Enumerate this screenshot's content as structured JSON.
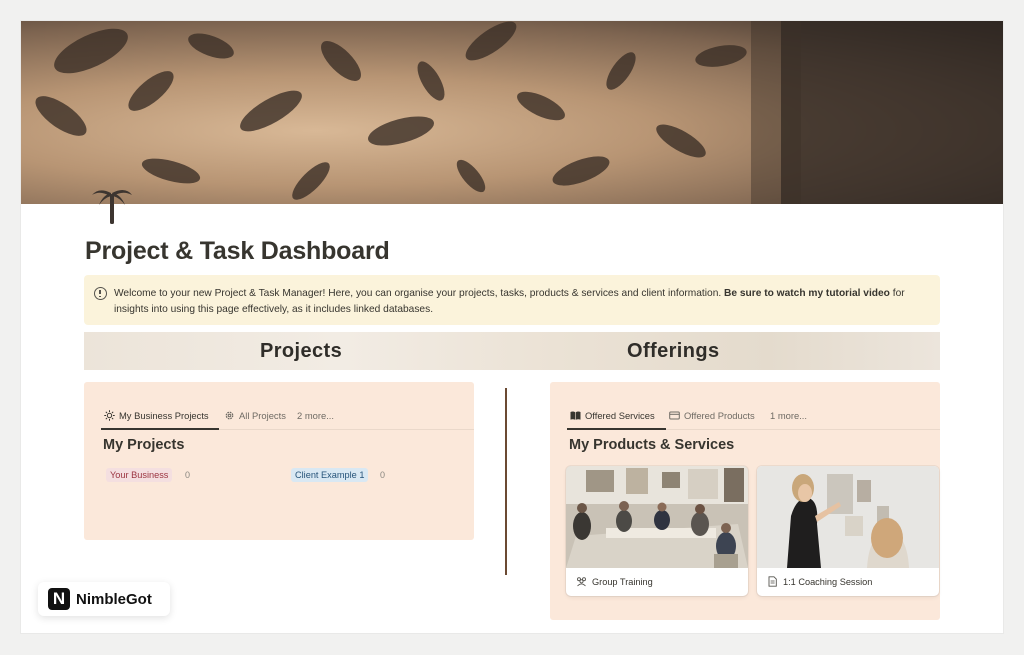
{
  "page": {
    "title": "Project & Task Dashboard",
    "callout": {
      "text_plain": "Welcome to your new Project & Task Manager! Here, you can organise your projects, tasks, products & services and client information. ",
      "text_bold": "Be sure to watch my tutorial video",
      "text_after": " for insights into using this page effectively, as it includes linked databases."
    },
    "sections": {
      "left": "Projects",
      "right": "Offerings"
    }
  },
  "projects": {
    "tabs": [
      {
        "label": "My Business Projects",
        "icon": "sun-icon",
        "active": true
      },
      {
        "label": "All Projects",
        "icon": "gear-icon",
        "active": false
      },
      {
        "label": "2 more...",
        "icon": null,
        "active": false
      }
    ],
    "title": "My Projects",
    "groups": [
      {
        "label": "Your Business",
        "count": "0",
        "color": "#f4dfe0",
        "text_color": "#9b3440"
      },
      {
        "label": "Client Example 1",
        "count": "0",
        "color": "#d9e8f3",
        "text_color": "#27547a"
      }
    ]
  },
  "offerings": {
    "tabs": [
      {
        "label": "Offered Services",
        "icon": "book-icon",
        "active": true
      },
      {
        "label": "Offered Products",
        "icon": "card-icon",
        "active": false
      },
      {
        "label": "1 more...",
        "icon": null,
        "active": false
      }
    ],
    "title": "My Products & Services",
    "cards": [
      {
        "label": "Group Training",
        "icon": "group-icon"
      },
      {
        "label": "1:1 Coaching Session",
        "icon": "document-icon"
      }
    ]
  },
  "badge": {
    "mark": "N",
    "brand": "NimbleGot"
  },
  "colors": {
    "panel_bg": "#fbe8da",
    "callout_bg": "#fbf3db",
    "divider": "#6b4a33"
  }
}
